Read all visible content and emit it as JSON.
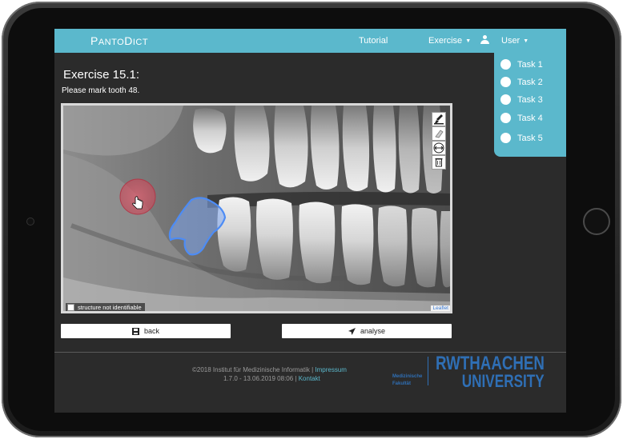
{
  "app": {
    "brand_big": "P",
    "brand_rest": "ANTO",
    "brand_big2": "D",
    "brand_rest2": "ICT"
  },
  "nav": {
    "tutorial": "Tutorial",
    "exercise": "Exercise",
    "user": "User"
  },
  "dropdown": {
    "tasks": [
      "Task 1",
      "Task 2",
      "Task 3",
      "Task 4",
      "Task 5"
    ]
  },
  "exercise": {
    "title": "Exercise 15.1:",
    "instruction": "Please mark tooth 48."
  },
  "viewer": {
    "checkbox_label": "structure not identifiable",
    "attribution": "Leaflet",
    "tools": [
      "brush-icon",
      "eraser-icon",
      "pan-icon",
      "trash-icon"
    ]
  },
  "buttons": {
    "back": "back",
    "analyse": "analyse"
  },
  "footer": {
    "copyright": "©2018 Institut für Medizinische Informatik |",
    "impressum": "Impressum",
    "version": "1.7.0 - 13.06.2019 08:06 |",
    "kontakt": "Kontakt",
    "faculty_line1": "Medizinische",
    "faculty_line2": "Fakultät",
    "uni_line1": "RWTHAACHEN",
    "uni_line2": "UNIVERSITY"
  },
  "colors": {
    "accent": "#5bb8cc",
    "page_bg": "#2b2b2b",
    "rwth_blue": "#2f6fb5",
    "marker_red": "#e05a6a",
    "selection_blue": "#4d8cf5"
  }
}
